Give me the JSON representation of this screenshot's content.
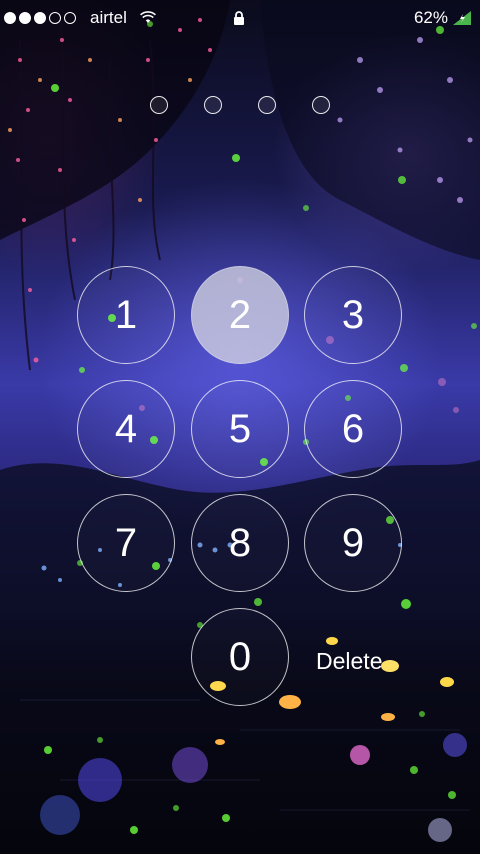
{
  "status_bar": {
    "carrier": "airtel",
    "battery": "62%",
    "signal_icons": [
      "signal-dot-icon",
      "wifi-icon",
      "lock-icon",
      "battery-charging-icon"
    ]
  },
  "passcode": {
    "entered": 0,
    "length": 4
  },
  "keypad": {
    "k1": "1",
    "k2": "2",
    "k3": "3",
    "k4": "4",
    "k5": "5",
    "k6": "6",
    "k7": "7",
    "k8": "8",
    "k9": "9",
    "k0": "0",
    "delete": "Delete",
    "pressed": "2"
  },
  "colors": {
    "sky": "#3a3aa8",
    "firefly": "#6cff3c",
    "lotus": "#ffb347"
  }
}
